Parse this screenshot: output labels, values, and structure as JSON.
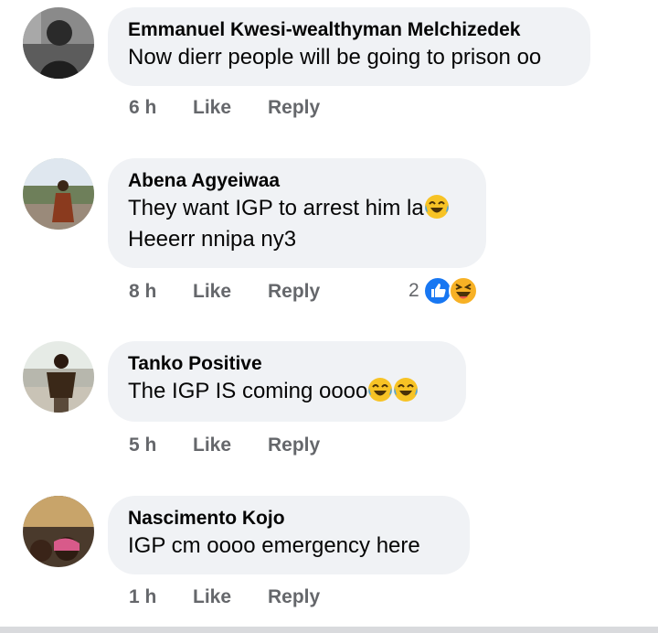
{
  "comments": [
    {
      "author": "Emmanuel Kwesi-wealthyman Melchizedek",
      "lines": [
        "Now dierr people will be going to prison oo"
      ],
      "time": "6 h",
      "like_label": "Like",
      "reply_label": "Reply"
    },
    {
      "author": "Abena Agyeiwaa",
      "lines": [
        "They want IGP to arrest him la",
        "Heeerr nnipa ny3"
      ],
      "time": "8 h",
      "like_label": "Like",
      "reply_label": "Reply",
      "reaction_count": "2"
    },
    {
      "author": "Tanko Positive",
      "lines": [
        "The  IGP IS coming oooo"
      ],
      "time": "5 h",
      "like_label": "Like",
      "reply_label": "Reply"
    },
    {
      "author": "Nascimento Kojo",
      "lines": [
        "IGP  cm oooo emergency here"
      ],
      "time": "1 h",
      "like_label": "Like",
      "reply_label": "Reply"
    }
  ],
  "icons": {
    "laugh_emoji": "tears-of-joy-emoji",
    "like_reaction": "like-reaction-icon",
    "haha_reaction": "haha-reaction-icon"
  },
  "colors": {
    "bubble": "#f0f2f5",
    "meta_text": "#65676b",
    "like_blue": "#1877f2",
    "haha_yellow": "#f7b125"
  }
}
